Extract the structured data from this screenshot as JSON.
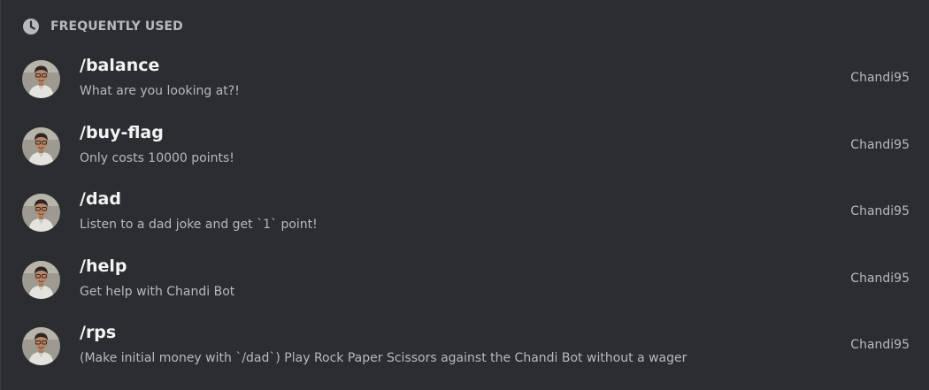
{
  "section": {
    "title": "FREQUENTLY USED",
    "icon": "clock-icon"
  },
  "commands": [
    {
      "name": "/balance",
      "description": "What are you looking at?!",
      "source": "Chandi95"
    },
    {
      "name": "/buy-flag",
      "description": "Only costs 10000 points!",
      "source": "Chandi95"
    },
    {
      "name": "/dad",
      "description": "Listen to a dad joke and get `1` point!",
      "source": "Chandi95"
    },
    {
      "name": "/help",
      "description": "Get help with Chandi Bot",
      "source": "Chandi95"
    },
    {
      "name": "/rps",
      "description": "(Make initial money with `/dad`) Play Rock Paper Scissors against the Chandi Bot without a wager",
      "source": "Chandi95"
    }
  ],
  "colors": {
    "background": "#2b2d31",
    "header_text": "#b5bac1",
    "command_text": "#f2f3f5",
    "muted_text": "#b5bac1"
  }
}
